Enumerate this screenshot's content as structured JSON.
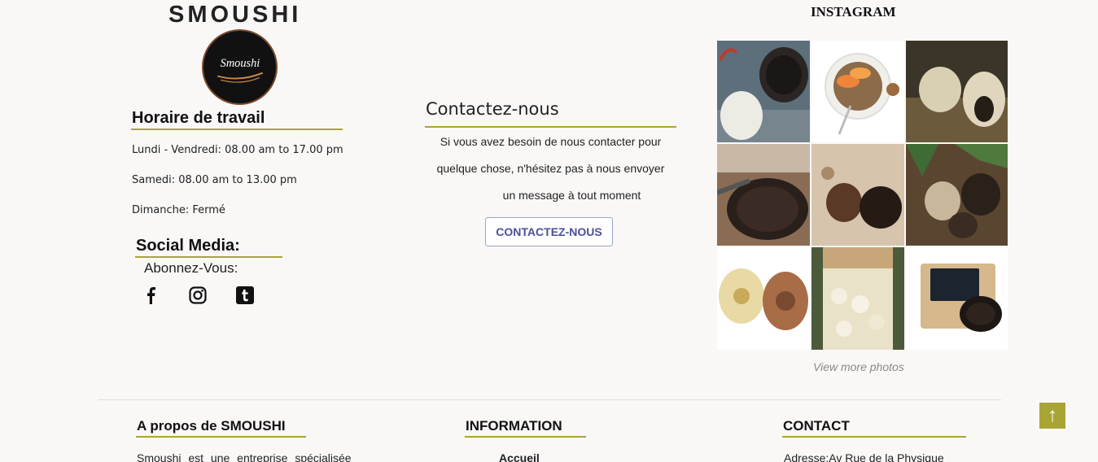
{
  "brand": {
    "name": "SMOUSHI",
    "logo_text": "Smoushi"
  },
  "hours": {
    "title": "Horaire de travail",
    "lines": [
      "Lundi - Vendredi: 08.00 am to 17.00 pm",
      "Samedi: 08.00 am to 13.00 pm",
      "Dimanche: Fermé"
    ]
  },
  "social": {
    "title": "Social Media:",
    "subscribe": "Abonnez-Vous:",
    "icons": [
      "facebook-icon",
      "instagram-icon",
      "tumblr-icon"
    ]
  },
  "contact": {
    "title": "Contactez-nous",
    "lines": [
      "Si vous avez besoin de nous contacter pour",
      "quelque chose, n'hésitez pas à nous envoyer",
      "un message à tout moment"
    ],
    "button": "CONTACTEZ-NOUS"
  },
  "instagram": {
    "title": "INSTAGRAM",
    "view_more": "View more photos"
  },
  "footer": {
    "about_title": "A propos de SMOUSHI",
    "about_text": "Smoushi est une entreprise spécialisée",
    "info_title": "INFORMATION",
    "info_link": "Accueil",
    "contact_title": "CONTACT",
    "contact_text": "Adresse:Av Rue de la Physique"
  },
  "scroll_top": {
    "label": "↑"
  },
  "colors": {
    "accent": "#a9a535",
    "button_text": "#4a4f9c",
    "background": "#faf8f7"
  }
}
